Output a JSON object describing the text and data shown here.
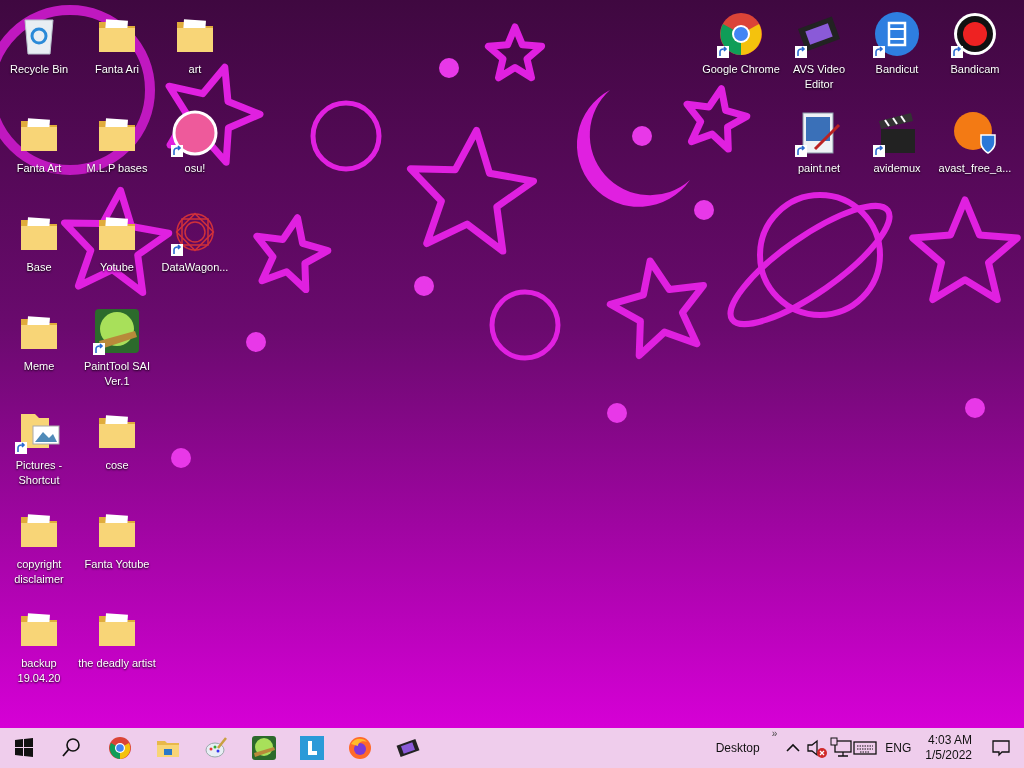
{
  "desktop": {
    "left_columns": [
      [
        {
          "label": "Recycle Bin",
          "kind": "recycle-bin",
          "shortcut": false
        },
        {
          "label": "Fanta Art",
          "kind": "folder",
          "shortcut": false
        },
        {
          "label": "Base",
          "kind": "folder",
          "shortcut": false
        },
        {
          "label": "Meme",
          "kind": "folder",
          "shortcut": false
        },
        {
          "label": "Pictures - Shortcut",
          "kind": "pictures",
          "shortcut": true
        },
        {
          "label": "copyright disclaimer",
          "kind": "folder",
          "shortcut": false
        },
        {
          "label": "backup 19.04.20",
          "kind": "folder",
          "shortcut": false
        }
      ],
      [
        {
          "label": "Fanta Ari",
          "kind": "folder",
          "shortcut": false
        },
        {
          "label": "M.L.P bases",
          "kind": "folder",
          "shortcut": false
        },
        {
          "label": "Yotube",
          "kind": "folder",
          "shortcut": false
        },
        {
          "label": "PaintTool SAI Ver.1",
          "kind": "paint-ball",
          "shortcut": true
        },
        {
          "label": "cose",
          "kind": "folder",
          "shortcut": false
        },
        {
          "label": "Fanta Yotube",
          "kind": "folder",
          "shortcut": false
        },
        {
          "label": "the deadly artist",
          "kind": "folder",
          "shortcut": false
        }
      ],
      [
        {
          "label": "art",
          "kind": "folder",
          "shortcut": false
        },
        {
          "label": "osu!",
          "kind": "pink-circle",
          "shortcut": true
        },
        {
          "label": "DataWagon...",
          "kind": "mandala",
          "shortcut": true
        }
      ]
    ],
    "right_rows": [
      [
        {
          "label": "Google Chrome",
          "kind": "chrome",
          "shortcut": true
        },
        {
          "label": "AVS Video Editor",
          "kind": "film",
          "shortcut": true
        },
        {
          "label": "Bandicut",
          "kind": "blue-film",
          "shortcut": true
        },
        {
          "label": "Bandicam",
          "kind": "record",
          "shortcut": true
        }
      ],
      [
        {
          "label": "paint.net",
          "kind": "paint-image",
          "shortcut": true
        },
        {
          "label": "avidemux",
          "kind": "clapper",
          "shortcut": true
        },
        {
          "label": "avast_free_a...",
          "kind": "shield",
          "shortcut": false
        }
      ]
    ]
  },
  "taskbar": {
    "apps": [
      {
        "kind": "start"
      },
      {
        "kind": "search"
      },
      {
        "kind": "chrome"
      },
      {
        "kind": "explorer"
      },
      {
        "kind": "palette"
      },
      {
        "kind": "paint-ball"
      },
      {
        "kind": "blue-tile"
      },
      {
        "kind": "firefox"
      },
      {
        "kind": "film"
      }
    ],
    "toolbar": {
      "label": "Desktop",
      "overflow": "»"
    },
    "tray": [
      {
        "kind": "chevron"
      },
      {
        "kind": "speaker-muted"
      },
      {
        "kind": "network"
      },
      {
        "kind": "keyboard"
      }
    ],
    "language": "ENG",
    "time": "4:03 AM",
    "date": "1/5/2022"
  }
}
